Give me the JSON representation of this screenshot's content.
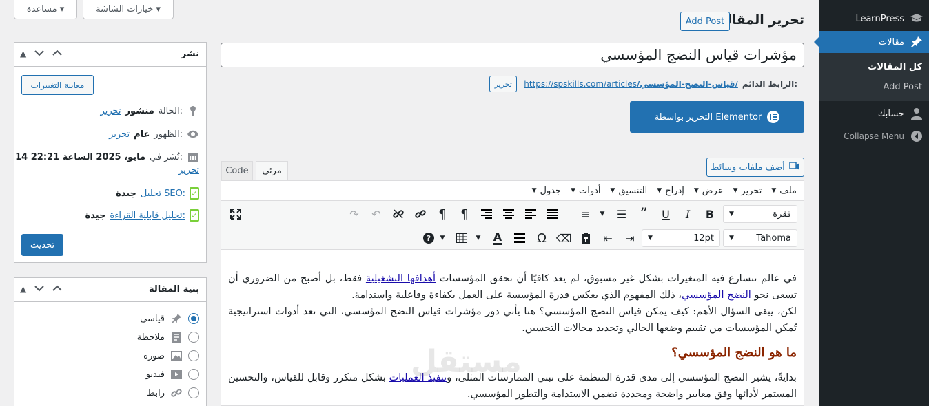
{
  "sidebar": {
    "brand": "LearnPress",
    "posts_label": "مقالات",
    "sub_items": [
      "كل المقالات",
      "Add Post"
    ],
    "account_label": "حسابك",
    "collapse_label": "Collapse Menu"
  },
  "top": {
    "screen_options": "خيارات الشاشة ▾",
    "help": "مساعدة ▾"
  },
  "header": {
    "title": "تحرير المقالة",
    "add_post": "Add Post"
  },
  "post": {
    "title": "مؤشرات قياس النضج المؤسسي",
    "permalink_label": "الرابط الدائم:",
    "permalink_base": "https://spskills.com/articles",
    "permalink_slug": "/قياس-النضج-المؤسسي/",
    "permalink_edit": "تحرير",
    "elementor_label": "التحرير بواسطة Elementor",
    "add_media": "أضف ملفات وسائط"
  },
  "editor_tabs": {
    "visual": "مرئي",
    "code": "Code"
  },
  "menubar": [
    "ملف",
    "تحرير",
    "عرض",
    "إدراج",
    "التنسيق",
    "أدوات",
    "جدول"
  ],
  "toolbar": {
    "format_select": "فقرة",
    "font_family": "Tahoma",
    "font_size": "12pt"
  },
  "content": {
    "p1_a": "في عالم تتسارع فيه المتغيرات بشكل غير مسبوق، لم يعد كافيًا أن تحقق المؤسسات ",
    "p1_link1": "أهدافها التشغيلية",
    "p1_b": " فقط، بل أصبح من الضروري أن تسعى نحو ",
    "p1_link2": "النضج المؤسسي",
    "p1_c": "، ذلك المفهوم الذي يعكس قدرة المؤسسة على العمل بكفاءة وفاعلية واستدامة.",
    "p2": "لكن، يبقى السؤال الأهم: كيف يمكن قياس النضج المؤسسي؟ هنا يأتي دور مؤشرات قياس النضج المؤسسي، التي تعد أدوات استراتيجية تُمكن المؤسسات من تقييم وضعها الحالي وتحديد مجالات التحسين.",
    "h2": "ما هو النضج المؤسسي؟",
    "p3_a": "بدايةً، يشير النضج المؤسسي إلى مدى قدرة المنظمة على تبني الممارسات المثلى، و",
    "p3_link": "تنفيذ العمليات",
    "p3_b": " بشكل متكرر وقابل للقياس، والتحسين المستمر لأدائها وفق معايير واضحة ومحددة تضمن الاستدامة والتطور المؤسسي."
  },
  "watermark": "مستقل",
  "publish": {
    "title": "نشر",
    "preview": "معاينة التغييرات",
    "status_label": "الحالة:",
    "status_value": "منشور",
    "visibility_label": "الظهور:",
    "visibility_value": "عام",
    "published_label": "نُشر في:",
    "published_value": "14 مايو، 2025 الساعة 22:21",
    "edit": "تحرير",
    "seo_label": "تحليل SEO:",
    "seo_value": "جيدة",
    "readability_label": "تحليل قابلية القراءة:",
    "readability_value": "جيدة",
    "update": "تحديث"
  },
  "format_box": {
    "title": "بنية المقالة",
    "options": [
      "قياسي",
      "ملاحظة",
      "صورة",
      "فيديو",
      "رابط"
    ],
    "selected": "قياسي"
  }
}
